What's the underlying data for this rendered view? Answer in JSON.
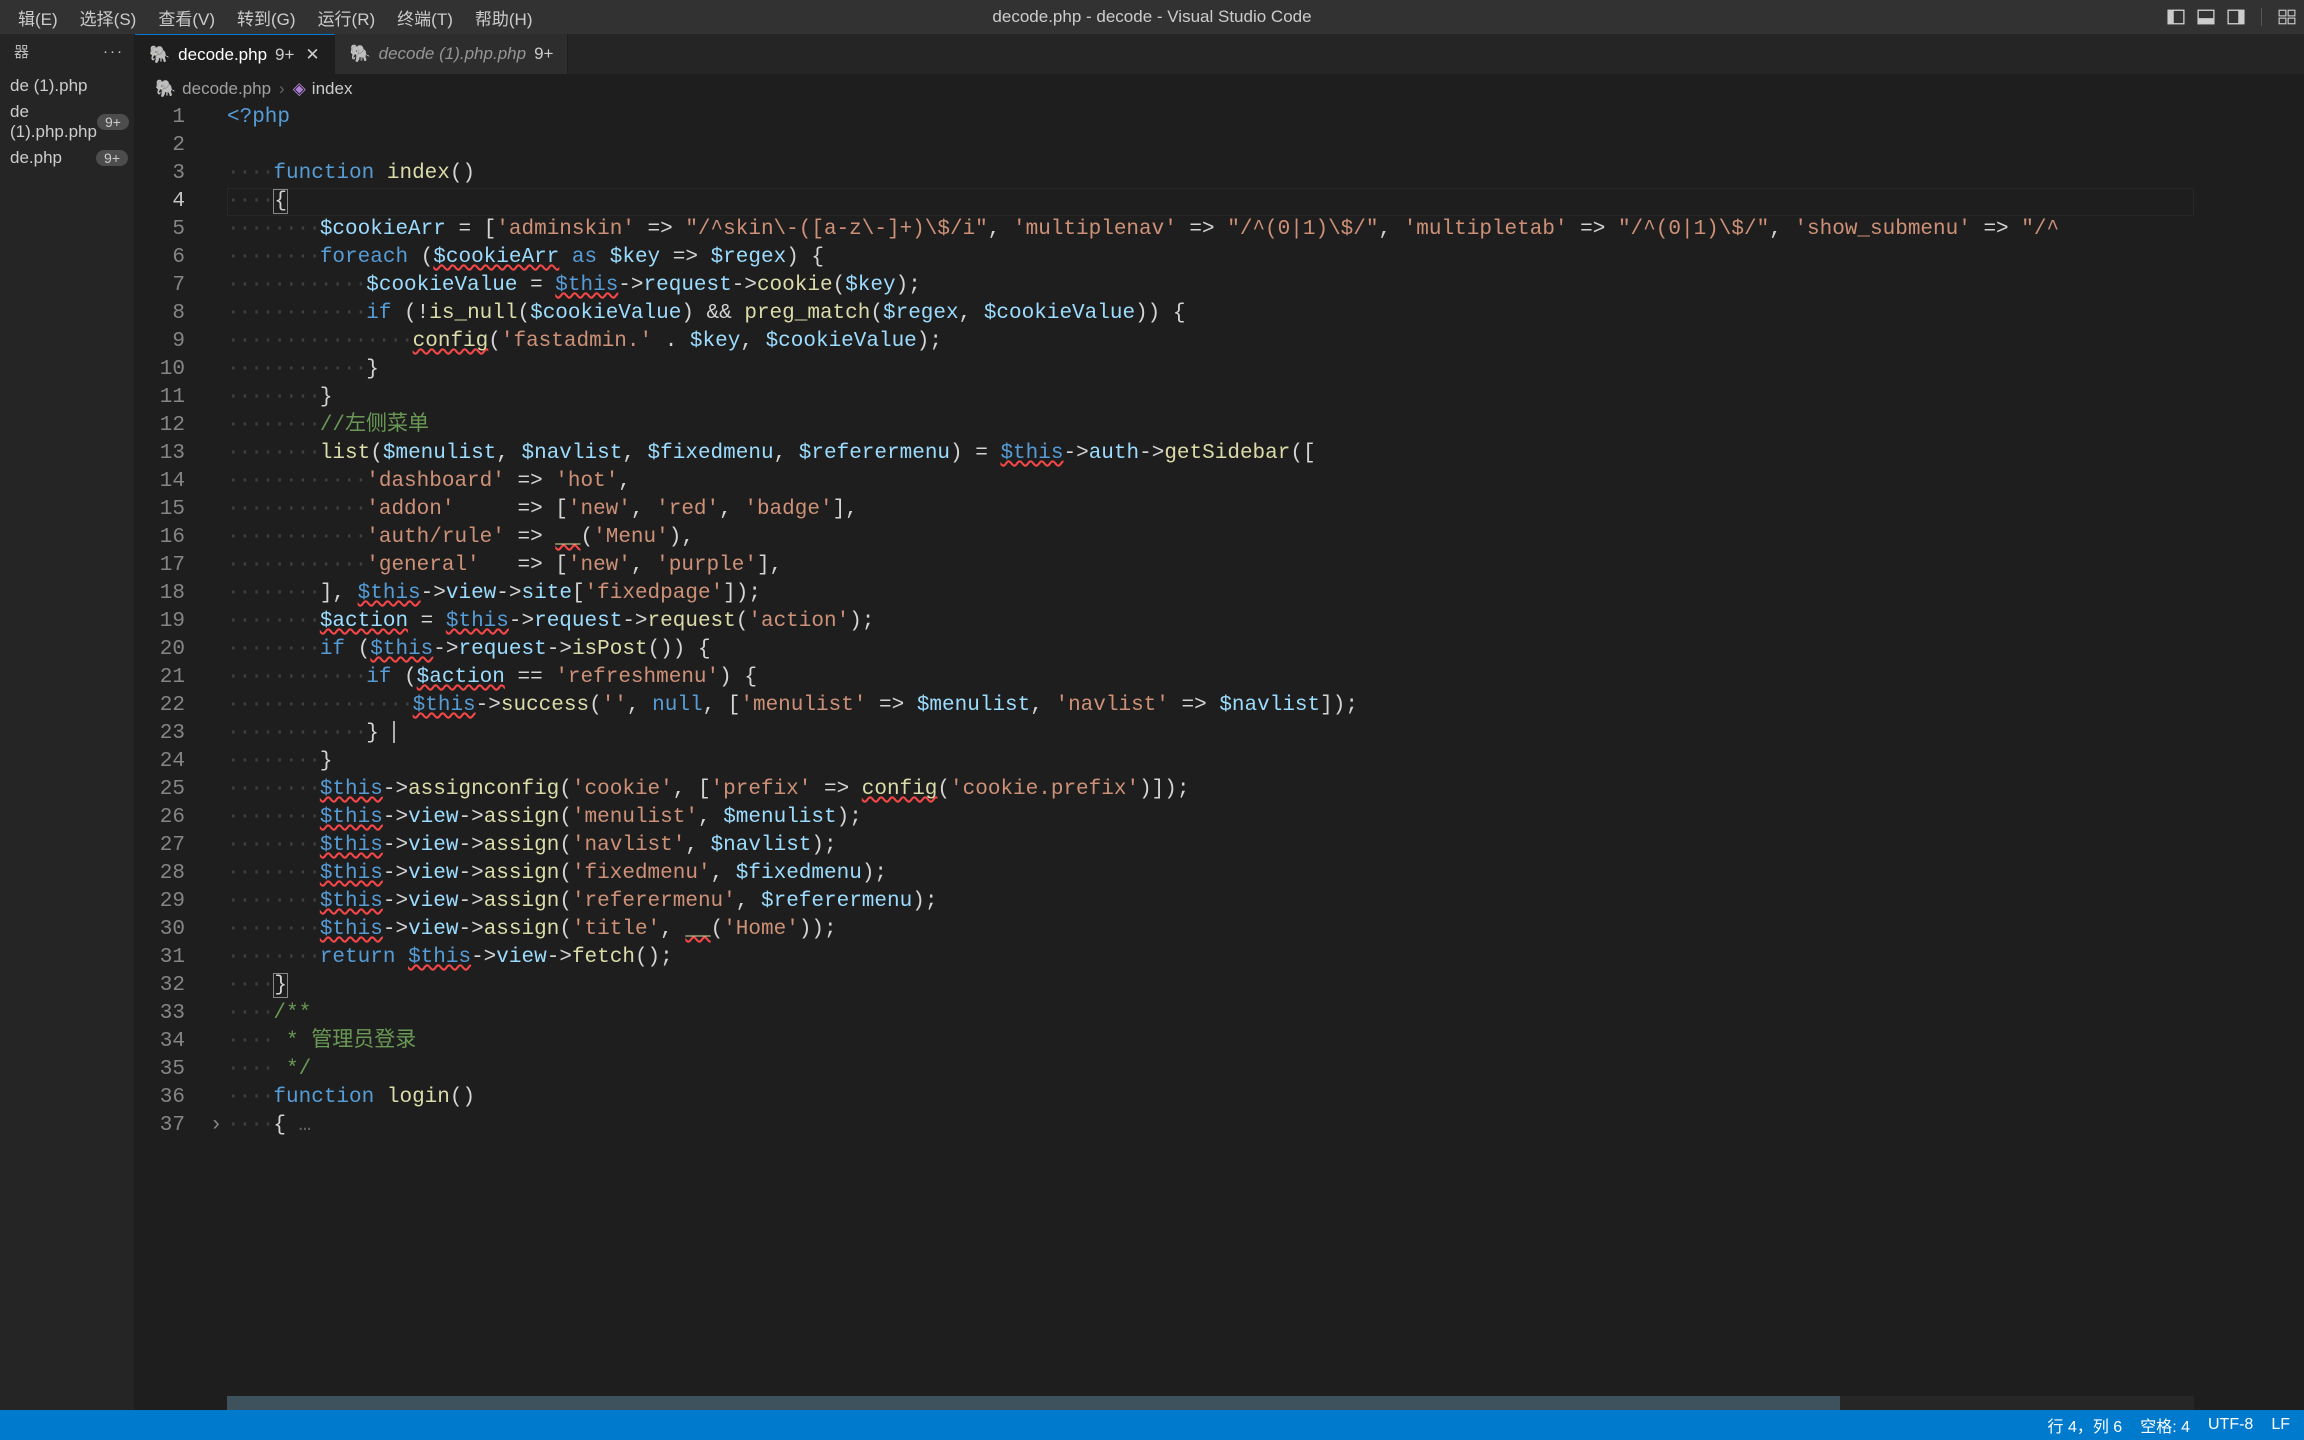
{
  "menubar": {
    "items": [
      "辑(E)",
      "选择(S)",
      "查看(V)",
      "转到(G)",
      "运行(R)",
      "终端(T)",
      "帮助(H)"
    ],
    "title": "decode.php - decode - Visual Studio Code"
  },
  "sidebar": {
    "header": "器",
    "files": [
      {
        "name": "de (1).php",
        "badge": ""
      },
      {
        "name": "de (1).php.php",
        "badge": "9+"
      },
      {
        "name": "de.php",
        "badge": "9+"
      }
    ]
  },
  "tabs": [
    {
      "name": "decode.php",
      "badge": "9+",
      "active": true,
      "close": true
    },
    {
      "name": "decode (1).php.php",
      "badge": "9+",
      "active": false,
      "close": false
    }
  ],
  "breadcrumb": {
    "file": "decode.php",
    "symbol": "index"
  },
  "code": {
    "line1": "<?php",
    "line3_fn": "function",
    "line3_name": "index",
    "line5_var": "$cookieArr",
    "line5_k1": "'adminskin'",
    "line5_v1": "\"/^skin\\-([a-z\\-]+)\\$/i\"",
    "line5_k2": "'multiplenav'",
    "line5_v2": "\"/^(0|1)\\$/\"",
    "line5_k3": "'multipletab'",
    "line5_v3": "\"/^(0|1)\\$/\"",
    "line5_k4": "'show_submenu'",
    "line6_foreach": "foreach",
    "line6_as": "as",
    "line6_key": "$key",
    "line6_regex": "$regex",
    "line7_cookieValue": "$cookieValue",
    "line7_this": "$this",
    "line7_request": "request",
    "line7_cookie": "cookie",
    "line8_if": "if",
    "line8_isnull": "is_null",
    "line8_preg": "preg_match",
    "line9_config": "config",
    "line9_str": "'fastadmin.'",
    "line12_cmt": "//左侧菜单",
    "line13_list": "list",
    "line13_menulist": "$menulist",
    "line13_navlist": "$navlist",
    "line13_fixedmenu": "$fixedmenu",
    "line13_referermenu": "$referermenu",
    "line13_auth": "auth",
    "line13_getSidebar": "getSidebar",
    "line14_dashboard": "'dashboard'",
    "line14_hot": "'hot'",
    "line15_addon": "'addon'",
    "line15_new": "'new'",
    "line15_red": "'red'",
    "line15_badge": "'badge'",
    "line16_authrule": "'auth/rule'",
    "line16_menu": "'Menu'",
    "line17_general": "'general'",
    "line17_purple": "'purple'",
    "line18_view": "view",
    "line18_site": "site",
    "line18_fixedpage": "'fixedpage'",
    "line19_action": "$action",
    "line19_request2": "request",
    "line19_actionstr": "'action'",
    "line20_isPost": "isPost",
    "line21_refreshmenu": "'refreshmenu'",
    "line22_success": "success",
    "line22_null": "null",
    "line22_menuliststr": "'menulist'",
    "line22_navliststr": "'navlist'",
    "line25_assignconfig": "assignconfig",
    "line25_cookiestr": "'cookie'",
    "line25_prefix": "'prefix'",
    "line25_cookieprefix": "'cookie.prefix'",
    "line26_assign": "assign",
    "line26_menuliststr": "'menulist'",
    "line27_navliststr": "'navlist'",
    "line28_fixedmenustr": "'fixedmenu'",
    "line29_referermenustr": "'referermenu'",
    "line30_title": "'title'",
    "line30_home": "'Home'",
    "line31_return": "return",
    "line31_fetch": "fetch",
    "line33_cmt": "/**",
    "line34_cmt": " * 管理员登录",
    "line35_cmt": " */",
    "line36_login": "login"
  },
  "statusbar": {
    "pos": "行 4，列 6",
    "spaces": "空格: 4",
    "encoding": "UTF-8",
    "eol": "LF"
  }
}
